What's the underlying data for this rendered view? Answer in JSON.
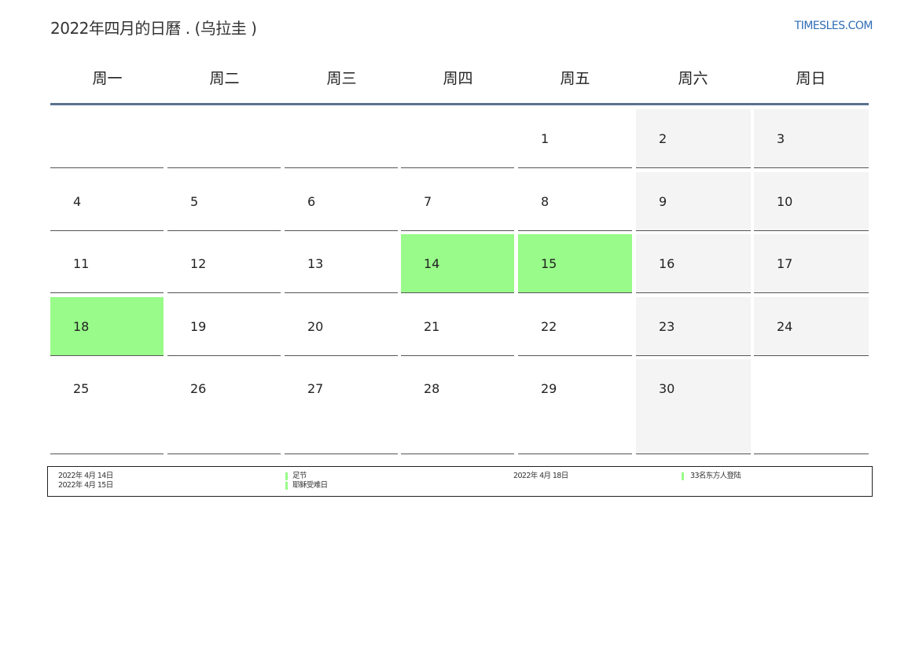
{
  "header": {
    "title": "2022年四月的日曆 . (乌拉圭 )",
    "site": "TIMESLES.COM"
  },
  "weekdays": [
    "周一",
    "周二",
    "周三",
    "周四",
    "周五",
    "周六",
    "周日"
  ],
  "weeks": [
    [
      "",
      "",
      "",
      "",
      "1",
      "2",
      "3"
    ],
    [
      "4",
      "5",
      "6",
      "7",
      "8",
      "9",
      "10"
    ],
    [
      "11",
      "12",
      "13",
      "14",
      "15",
      "16",
      "17"
    ],
    [
      "18",
      "19",
      "20",
      "21",
      "22",
      "23",
      "24"
    ],
    [
      "25",
      "26",
      "27",
      "28",
      "29",
      "30",
      ""
    ]
  ],
  "highlight_days": [
    "14",
    "15",
    "18"
  ],
  "legend": [
    {
      "date": "2022年 4月 14日",
      "name": "足节"
    },
    {
      "date": "2022年 4月 15日",
      "name": "耶稣受难日"
    },
    {
      "date": "2022年 4月 18日",
      "name": "33名东方人登陆"
    }
  ],
  "colors": {
    "holiday": "#99fb89",
    "weekend": "#f4f4f4",
    "header_rule": "#5b7290",
    "link": "#2f6db5"
  }
}
